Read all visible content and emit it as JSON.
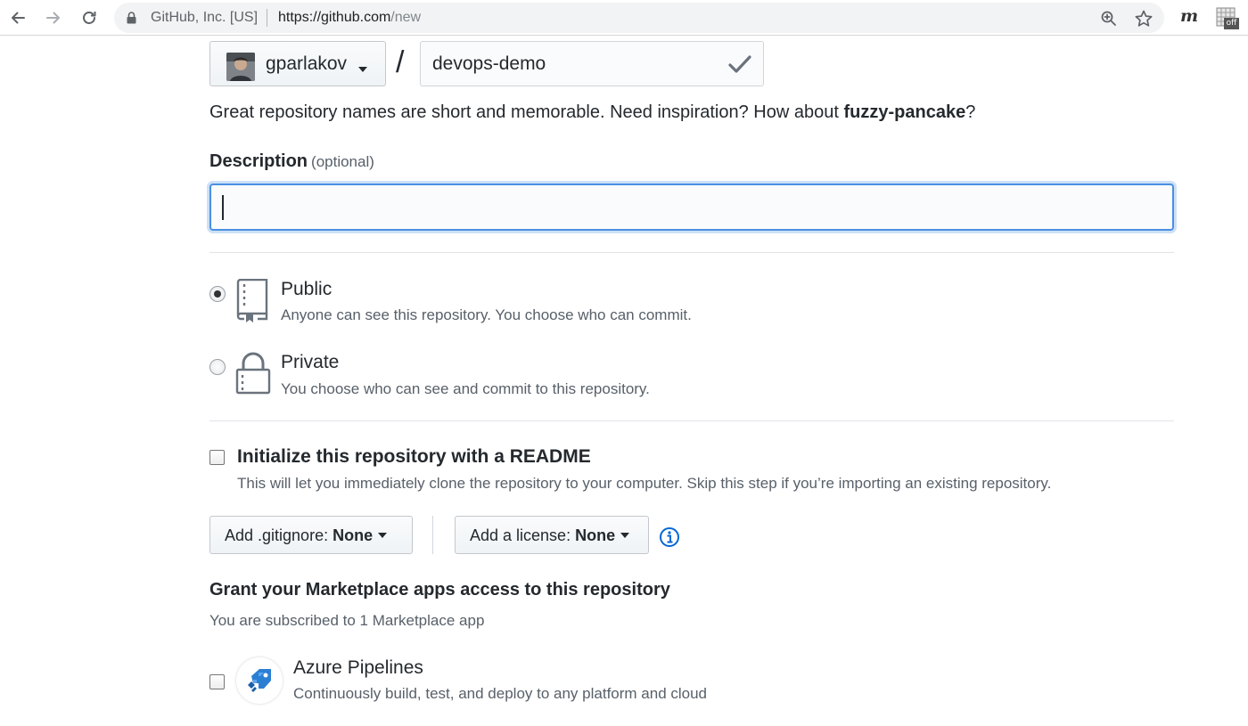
{
  "browser": {
    "site_identity": "GitHub, Inc. [US]",
    "url_host": "https://github.com",
    "url_path": "/new",
    "extension_m": "m",
    "extension_off": "off"
  },
  "form": {
    "owner": "gparlakov",
    "slash": "/",
    "repo_name": "devops-demo",
    "hint_prefix": "Great repository names are short and memorable. Need inspiration? How about ",
    "hint_suggestion": "fuzzy-pancake",
    "hint_suffix": "?",
    "description_label": "Description",
    "description_optional": "(optional)",
    "description_value": "",
    "visibility": [
      {
        "title": "Public",
        "description": "Anyone can see this repository. You choose who can commit.",
        "selected": true
      },
      {
        "title": "Private",
        "description": "You choose who can see and commit to this repository.",
        "selected": false
      }
    ],
    "readme_title": "Initialize this repository with a README",
    "readme_description": "This will let you immediately clone the repository to your computer. Skip this step if you’re importing an existing repository.",
    "gitignore_label": "Add .gitignore:",
    "gitignore_value": "None",
    "license_label": "Add a license:",
    "license_value": "None"
  },
  "marketplace": {
    "title": "Grant your Marketplace apps access to this repository",
    "subtitle": "You are subscribed to 1 Marketplace app",
    "apps": [
      {
        "name": "Azure Pipelines",
        "description": "Continuously build, test, and deploy to any platform and cloud",
        "icon": "azure-pipelines-icon"
      }
    ]
  },
  "colors": {
    "focus_blue": "#4a90e2",
    "info_blue": "#0366d6",
    "azure_blue": "#0078d7"
  }
}
